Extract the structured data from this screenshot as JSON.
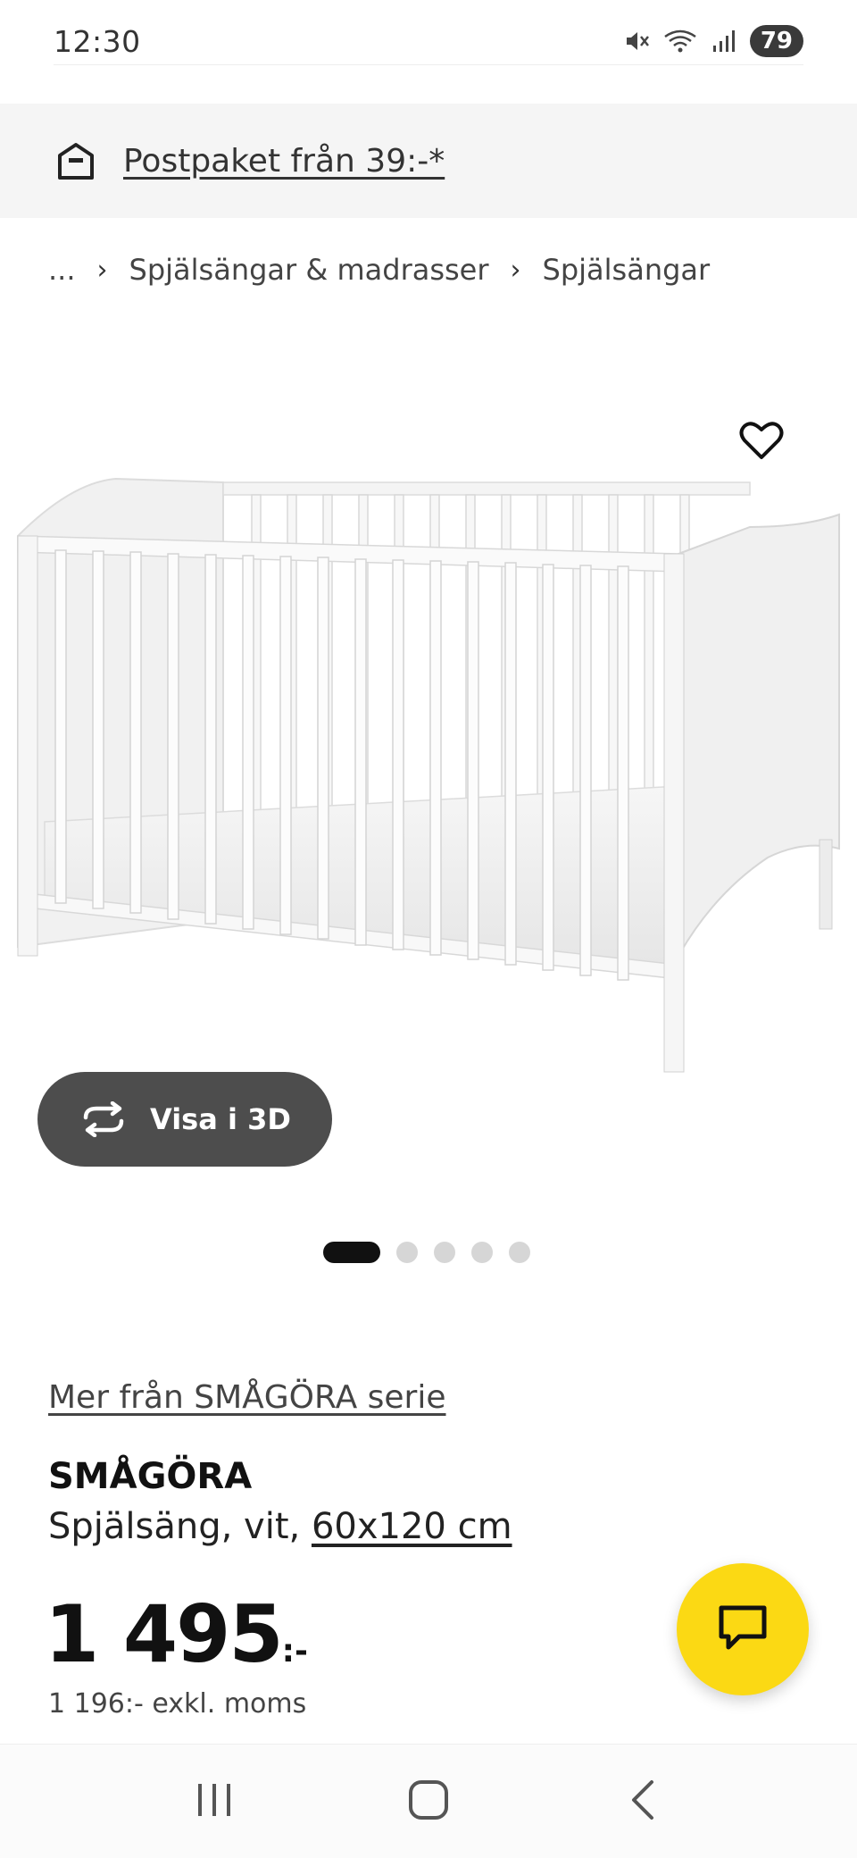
{
  "status_bar": {
    "time": "12:30",
    "battery": "79",
    "icons": [
      "mute-icon",
      "wifi-icon",
      "signal-icon"
    ]
  },
  "shipping_banner": {
    "text": "Postpaket från 39:-*",
    "icon": "delivery-box-icon"
  },
  "breadcrumb": {
    "ellipsis": "...",
    "separator": "›",
    "items": [
      "Spjälsängar & madrasser",
      "Spjälsängar"
    ]
  },
  "gallery": {
    "view3d_label": "Visa i 3D",
    "dot_count": 5,
    "active_index": 0
  },
  "product": {
    "series_link": "Mer från SMÅGÖRA serie",
    "name": "SMÅGÖRA",
    "desc_prefix": "Spjälsäng, vit, ",
    "size": "60x120 cm",
    "price_main": "1 495",
    "price_suffix": ":-",
    "price_ex_vat": "1 196:- exkl. moms"
  },
  "colors": {
    "chat_button": "#fbd914",
    "view3d_button": "#4d4d4d",
    "banner_bg": "#f5f5f5"
  }
}
